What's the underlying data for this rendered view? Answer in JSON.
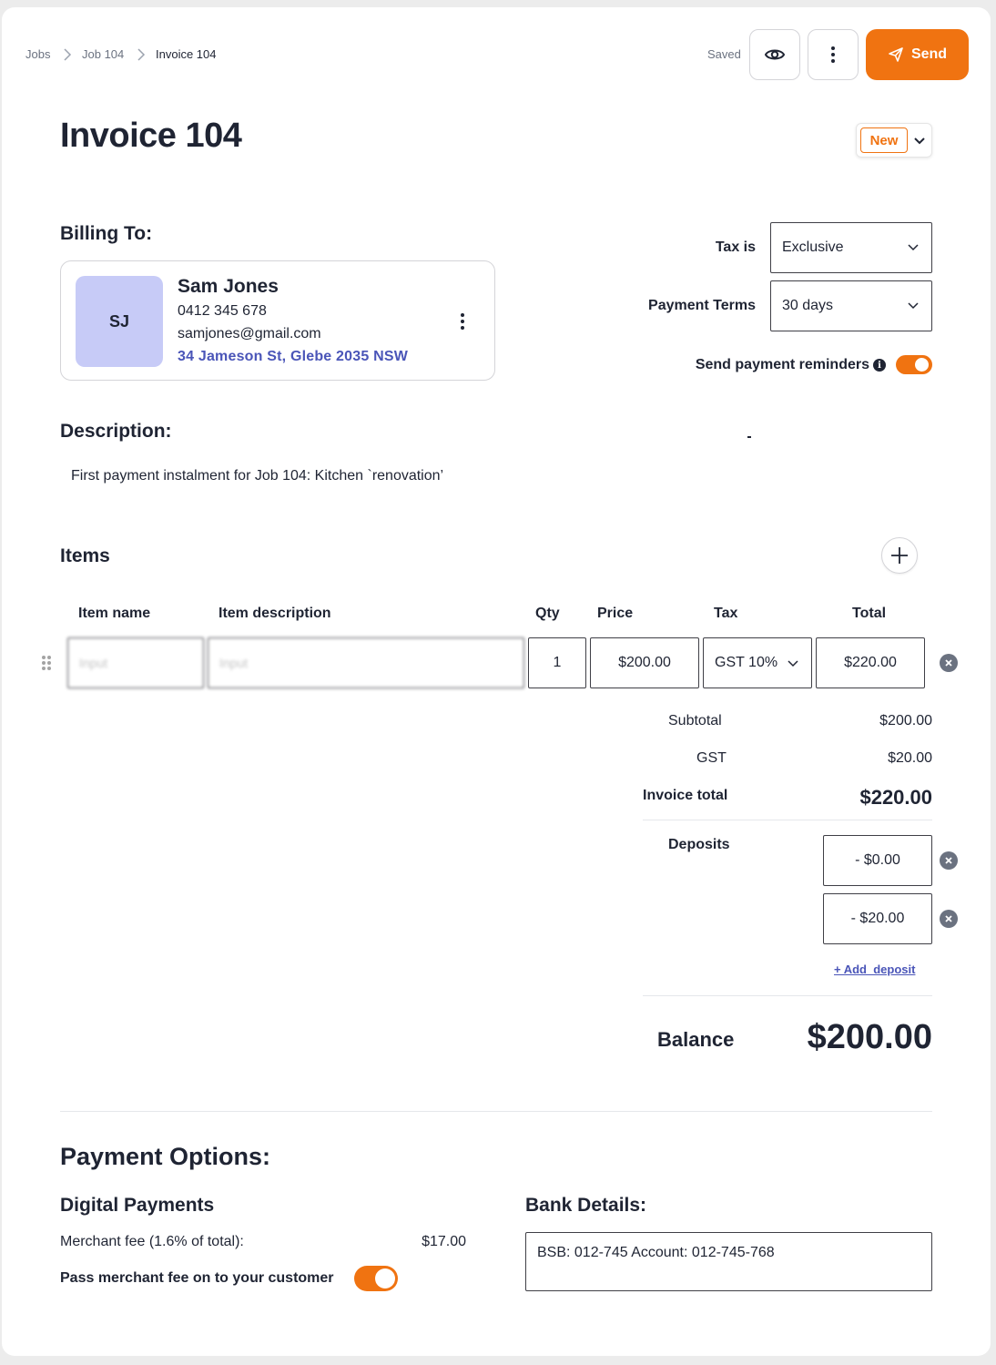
{
  "breadcrumb": [
    "Jobs",
    "Job 104",
    "Invoice 104"
  ],
  "header": {
    "saved_label": "Saved",
    "send_label": "Send"
  },
  "invoice": {
    "title": "Invoice 104",
    "status": "New"
  },
  "billing": {
    "heading": "Billing To:",
    "initials": "SJ",
    "name": "Sam Jones",
    "phone": "0412 345 678",
    "email": "samjones@gmail.com",
    "address": "34 Jameson St, Glebe 2035 NSW"
  },
  "settings": {
    "tax_label": "Tax is",
    "tax_value": "Exclusive",
    "terms_label": "Payment Terms",
    "terms_value": "30 days",
    "reminders_label": "Send payment reminders",
    "reminders_on": true
  },
  "description": {
    "heading": "Description:",
    "text": "First payment instalment for Job 104: Kitchen `renovation’"
  },
  "items": {
    "heading": "Items",
    "columns": [
      "Item name",
      "Item description",
      "Qty",
      "Price",
      "Tax",
      "Total"
    ],
    "rows": [
      {
        "name_placeholder": "Input",
        "desc_placeholder": "Input",
        "qty": "1",
        "price": "$200.00",
        "tax": "GST 10%",
        "total": "$220.00"
      }
    ]
  },
  "summary": {
    "subtotal_label": "Subtotal",
    "subtotal": "$200.00",
    "gst_label": "GST",
    "gst": "$20.00",
    "total_label": "Invoice total",
    "total": "$220.00",
    "deposits_label": "Deposits",
    "deposits": [
      "- $0.00",
      "- $20.00"
    ],
    "add_deposit": "+ Add  deposit",
    "balance_label": "Balance",
    "balance": "$200.00"
  },
  "payment": {
    "heading": "Payment Options:",
    "digital_heading": "Digital Payments",
    "fee_label": "Merchant fee (1.6% of total):",
    "fee_value": "$17.00",
    "pass_fee_label": "Pass merchant fee on to your customer",
    "pass_fee_on": true,
    "bank_heading": "Bank Details:",
    "bank_text": "BSB: 012-745 Account: 012-745-768"
  },
  "colors": {
    "accent": "#f07311",
    "link": "#4a55b8",
    "avatar_bg": "#c7cbf7"
  }
}
